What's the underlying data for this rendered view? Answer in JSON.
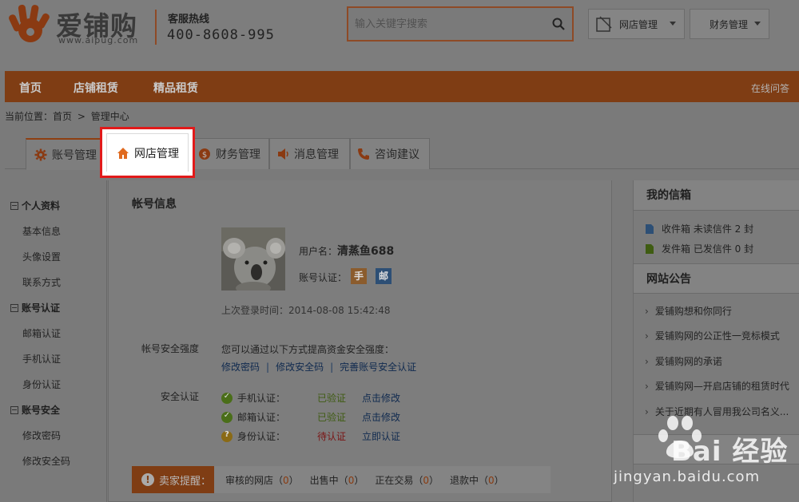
{
  "header": {
    "logo_text": "爱铺购",
    "logo_url": "www.aipug.com",
    "hotline_label": "客服热线",
    "hotline_number": "400-8608-995",
    "search_placeholder": "输入关键字搜索",
    "shop_manage_label": "网店管理",
    "finance_manage_label": "财务管理"
  },
  "nav": {
    "items": [
      "首页",
      "店铺租赁",
      "精品租赁"
    ],
    "help": "在线问答"
  },
  "breadcrumb": {
    "prefix": "当前位置：",
    "home": "首页",
    "sep": ">",
    "current": "管理中心"
  },
  "tabs": [
    {
      "label": "账号管理",
      "icon": "gear-icon"
    },
    {
      "label": "网店管理",
      "icon": "home-icon"
    },
    {
      "label": "财务管理",
      "icon": "coin-icon"
    },
    {
      "label": "消息管理",
      "icon": "speaker-icon"
    },
    {
      "label": "咨询建议",
      "icon": "phone-icon"
    }
  ],
  "sidebar": {
    "groups": [
      {
        "title": "个人资料",
        "items": [
          "基本信息",
          "头像设置",
          "联系方式"
        ]
      },
      {
        "title": "账号认证",
        "items": [
          "邮箱认证",
          "手机认证",
          "身份认证"
        ]
      },
      {
        "title": "账号安全",
        "items": [
          "修改密码",
          "修改安全码"
        ]
      }
    ]
  },
  "account": {
    "title": "帐号信息",
    "username_label": "用户名：",
    "username": "清蒸鱼688",
    "verify_label": "账号认证：",
    "badge_phone": "手",
    "badge_email": "邮",
    "last_login_label": "上次登录时间：",
    "last_login": "2014-08-08 15:42:48",
    "security_strength_label": "帐号安全强度",
    "security_tip": "您可以通过以下方式提高资金安全强度：",
    "security_links": [
      "修改密码",
      "修改安全码",
      "完善账号安全认证"
    ],
    "link_sep": "|",
    "auth_label": "安全认证",
    "auth_rows": [
      {
        "name": "手机认证：",
        "status": "已验证",
        "action": "点击修改",
        "state": "ok"
      },
      {
        "name": "邮箱认证：",
        "status": "已验证",
        "action": "点击修改",
        "state": "ok"
      },
      {
        "name": "身份认证：",
        "status": "待认证",
        "action": "立即认证",
        "state": "pending"
      }
    ]
  },
  "seller_bar": {
    "tag": "卖家提醒：",
    "items": [
      {
        "label": "审核的网店（",
        "num": "0",
        "end": "）"
      },
      {
        "label": "出售中（",
        "num": "0",
        "end": "）"
      },
      {
        "label": "正在交易（",
        "num": "0",
        "end": "）"
      },
      {
        "label": "退款中（",
        "num": "0",
        "end": "）"
      }
    ]
  },
  "right": {
    "mail_title": "我的信箱",
    "inbox": "收件箱 未读信件 2 封",
    "outbox": "发件箱 已发信件 0 封",
    "notice_title": "网站公告",
    "notices": [
      "爱铺购想和你同行",
      "爱铺购网的公正性一竞标模式",
      "爱铺购网的承诺",
      "爱铺购网—开启店铺的租赁时代",
      "关于近期有人冒用我公司名义..."
    ]
  },
  "watermark": {
    "brand": "Bai 经验",
    "url": "jingyan.baidu.com"
  },
  "colors": {
    "brand_orange": "#e06a1f",
    "highlight_red": "#e21a1a",
    "overlay": "#7a7a7a"
  }
}
